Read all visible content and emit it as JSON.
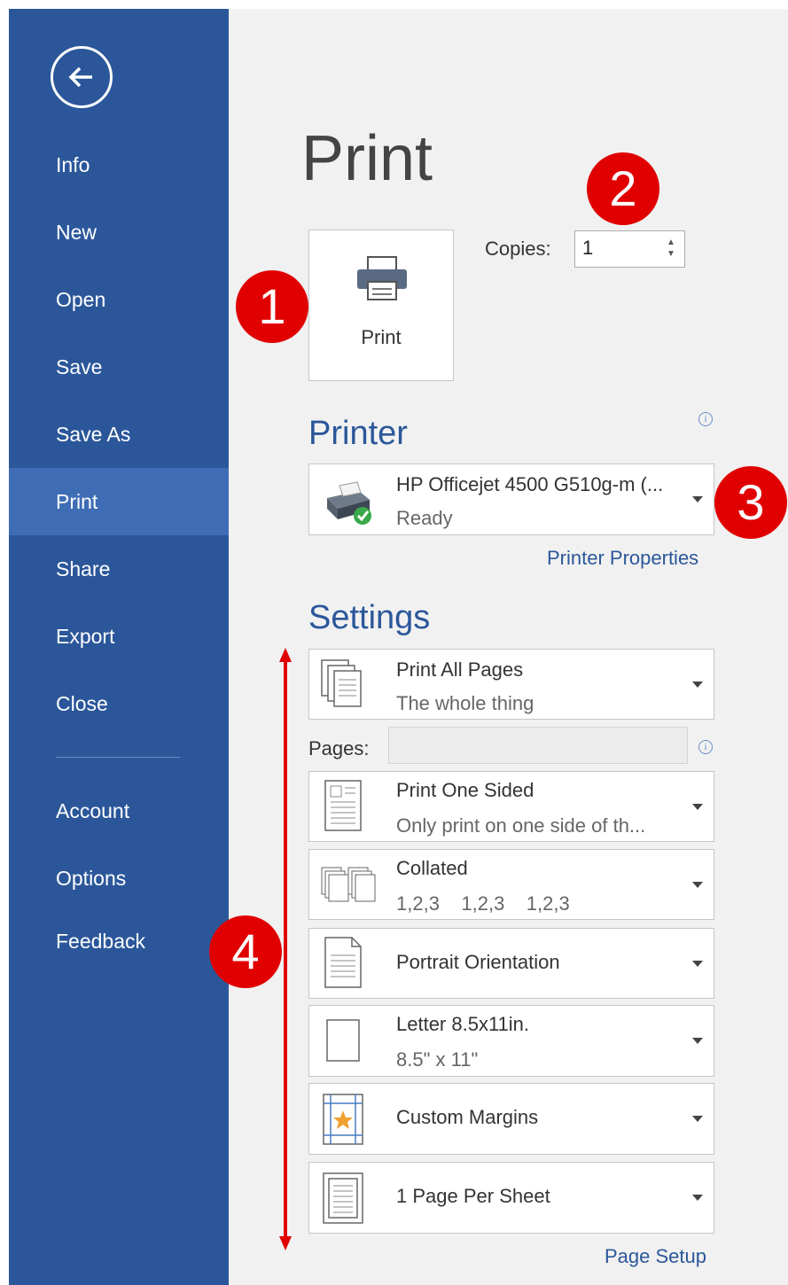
{
  "sidebar": {
    "items": [
      {
        "label": "Info"
      },
      {
        "label": "New"
      },
      {
        "label": "Open"
      },
      {
        "label": "Save"
      },
      {
        "label": "Save As"
      },
      {
        "label": "Print"
      },
      {
        "label": "Share"
      },
      {
        "label": "Export"
      },
      {
        "label": "Close"
      },
      {
        "label": "Account"
      },
      {
        "label": "Options"
      },
      {
        "label": "Feedback"
      }
    ],
    "active": "Print",
    "back_icon": "back-arrow-circle-icon"
  },
  "main": {
    "title": "Print",
    "print_button_label": "Print",
    "copies_label": "Copies:",
    "copies_value": "1"
  },
  "printer": {
    "heading": "Printer",
    "name": "HP Officejet 4500 G510g-m (...",
    "status": "Ready",
    "properties_link": "Printer Properties"
  },
  "settings": {
    "heading": "Settings",
    "pages_label": "Pages:",
    "pages_value": "",
    "items": [
      {
        "line1": "Print All Pages",
        "line2": "The whole thing",
        "icon": "pages-stack-icon"
      },
      {
        "line1": "Print One Sided",
        "line2": "Only print on one side of th...",
        "icon": "one-sided-icon"
      },
      {
        "line1": "Collated",
        "line2": "1,2,3    1,2,3    1,2,3",
        "icon": "collated-icon"
      },
      {
        "line1": "Portrait Orientation",
        "line2": "",
        "icon": "portrait-icon"
      },
      {
        "line1": "Letter 8.5x11in.",
        "line2": "8.5\" x 11\"",
        "icon": "letter-paper-icon"
      },
      {
        "line1": "Custom Margins",
        "line2": "",
        "icon": "margins-icon"
      },
      {
        "line1": "1 Page Per Sheet",
        "line2": "",
        "icon": "page-per-sheet-icon"
      }
    ],
    "page_setup_link": "Page Setup"
  },
  "annotations": [
    "1",
    "2",
    "3",
    "4"
  ],
  "colors": {
    "sidebar_bg": "#2b579a",
    "sidebar_active": "#3e6db5",
    "accent": "#2b579a",
    "badge": "#e00000"
  }
}
